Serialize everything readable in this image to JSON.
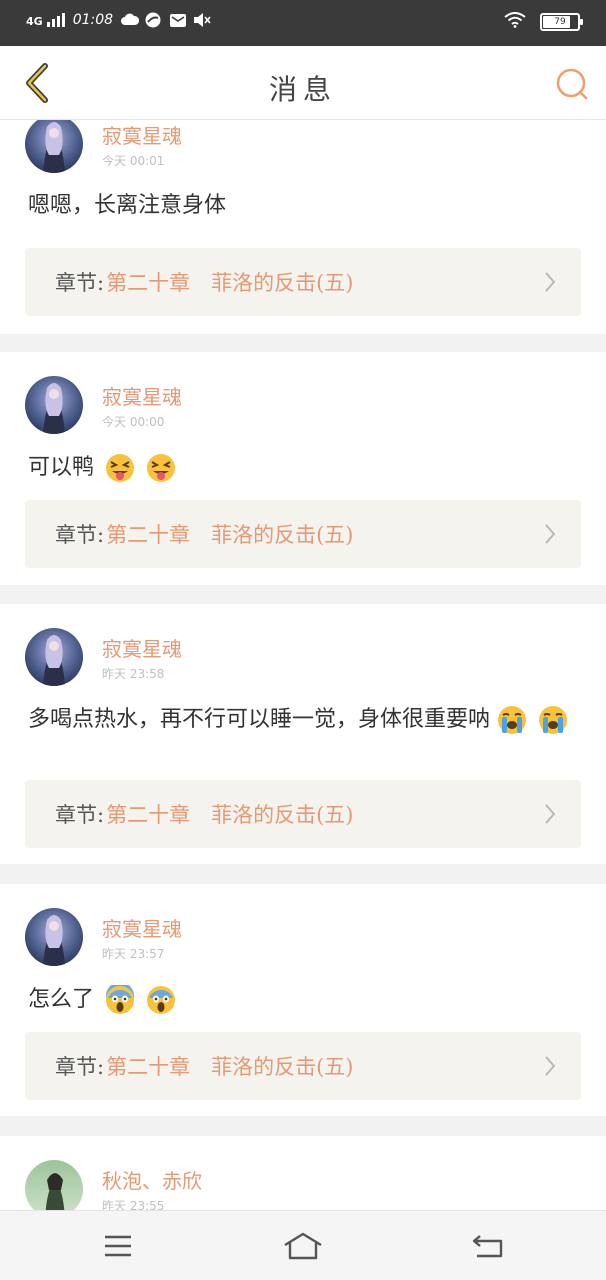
{
  "status_bar": {
    "network": "4G",
    "time": "01:08",
    "battery": "79",
    "battery_level": 0.79,
    "icons": [
      "signal-icon",
      "cloud-icon",
      "app-icon",
      "mail-icon",
      "mute-icon",
      "wifi-icon",
      "battery-icon"
    ]
  },
  "header": {
    "title": "消息",
    "back_icon": "chevron-left-icon",
    "search_icon": "search-icon",
    "accent": "#e49a74"
  },
  "messages": [
    {
      "user": "寂寞星魂",
      "time": "今天 00:01",
      "text": "嗯嗯，长离注意身体",
      "emojis": [],
      "chapter_label": "章节:",
      "chapter_name": "第二十章　菲洛的反击(五)"
    },
    {
      "user": "寂寞星魂",
      "time": "今天 00:00",
      "text": "可以鸭",
      "emojis": [
        "squinting-tongue-emoji",
        "squinting-tongue-emoji"
      ],
      "chapter_label": "章节:",
      "chapter_name": "第二十章　菲洛的反击(五)"
    },
    {
      "user": "寂寞星魂",
      "time": "昨天 23:58",
      "text": "多喝点热水，再不行可以睡一觉，身体很重要呐",
      "emojis": [
        "loudly-crying-emoji",
        "loudly-crying-emoji"
      ],
      "chapter_label": "章节:",
      "chapter_name": "第二十章　菲洛的反击(五)"
    },
    {
      "user": "寂寞星魂",
      "time": "昨天 23:57",
      "text": "怎么了",
      "emojis": [
        "screaming-fear-emoji",
        "screaming-fear-emoji"
      ],
      "chapter_label": "章节:",
      "chapter_name": "第二十章　菲洛的反击(五)"
    },
    {
      "user": "秋泡、赤欣",
      "time": "昨天 23:55"
    }
  ],
  "nav_bar": {
    "icons": [
      "menu-icon",
      "home-icon",
      "back-icon"
    ]
  }
}
